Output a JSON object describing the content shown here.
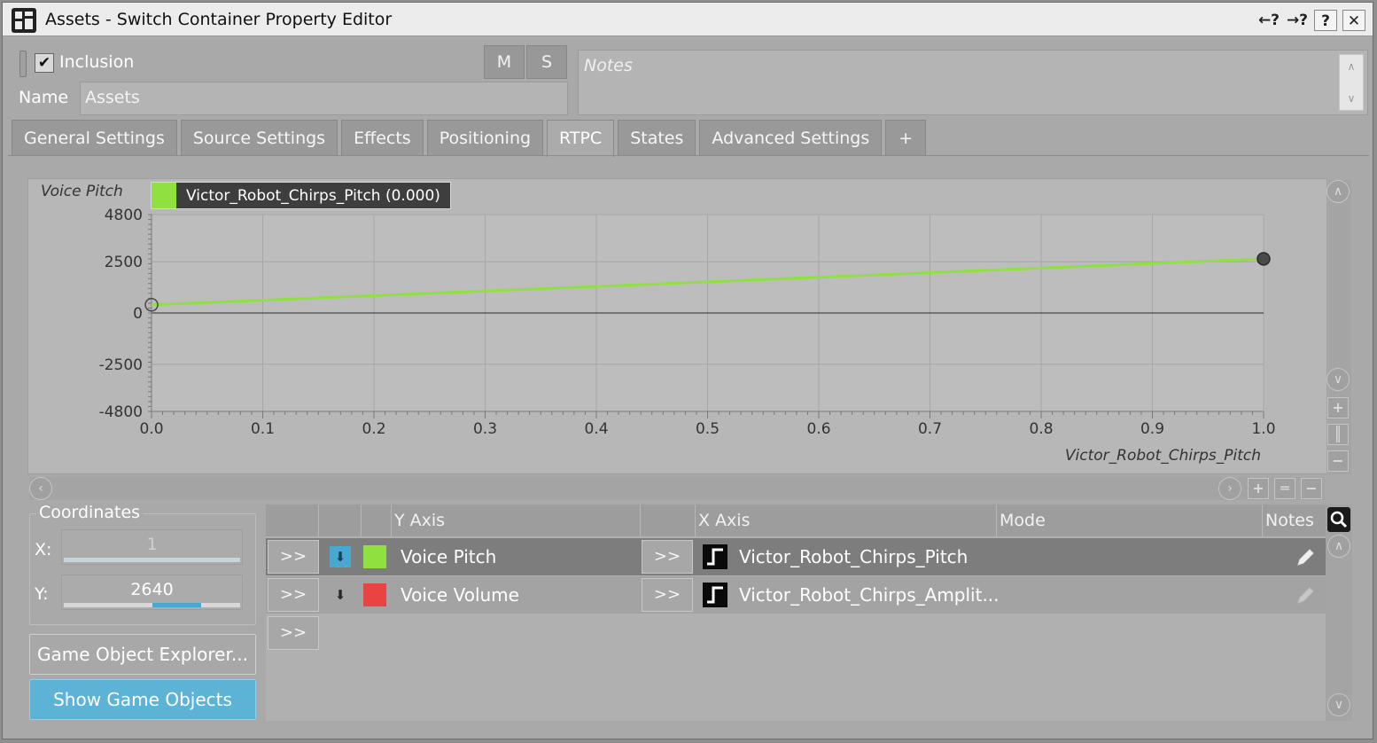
{
  "window": {
    "title": "Assets - Switch Container Property Editor",
    "title_buttons": [
      "¿?",
      "¿?",
      "?",
      "✕"
    ]
  },
  "header": {
    "inclusion_checked": true,
    "inclusion_label": "Inclusion",
    "name_label": "Name",
    "name_value": "Assets",
    "mute_label": "M",
    "solo_label": "S",
    "notes_placeholder": "Notes"
  },
  "tabs": [
    {
      "label": "General Settings",
      "active": false
    },
    {
      "label": "Source Settings",
      "active": false
    },
    {
      "label": "Effects",
      "active": false
    },
    {
      "label": "Positioning",
      "active": false
    },
    {
      "label": "RTPC",
      "active": true
    },
    {
      "label": "States",
      "active": false
    },
    {
      "label": "Advanced Settings",
      "active": false
    },
    {
      "label": "+",
      "active": false
    }
  ],
  "graph": {
    "y_axis_label": "Voice Pitch",
    "legend_label": "Victor_Robot_Chirps_Pitch (0.000)",
    "legend_color": "#90e040",
    "x_axis_label": "Victor_Robot_Chirps_Pitch",
    "y_ticks": [
      "4800",
      "2500",
      "0",
      "-2500",
      "-4800"
    ],
    "x_ticks": [
      "0.0",
      "0.1",
      "0.2",
      "0.3",
      "0.4",
      "0.5",
      "0.6",
      "0.7",
      "0.8",
      "0.9",
      "1.0"
    ]
  },
  "chart_data": {
    "type": "line",
    "title": "",
    "xlabel": "Victor_Robot_Chirps_Pitch",
    "ylabel": "Voice Pitch",
    "xlim": [
      0.0,
      1.0
    ],
    "ylim": [
      -4800,
      4800
    ],
    "grid": true,
    "legend": "top-left",
    "series": [
      {
        "name": "Victor_Robot_Chirps_Pitch (0.000)",
        "color": "#90e040",
        "x": [
          0.0,
          1.0
        ],
        "y": [
          400,
          2640
        ]
      }
    ]
  },
  "coordinates": {
    "title": "Coordinates",
    "x_label": "X:",
    "x_value": "1",
    "y_label": "Y:",
    "y_value": "2640",
    "y_level": 0.78
  },
  "buttons": {
    "game_object_explorer": "Game Object Explorer...",
    "show_game_objects": "Show Game Objects"
  },
  "rtpc_table": {
    "columns": [
      "Y Axis",
      "X Axis",
      "Mode",
      "Notes"
    ],
    "rows": [
      {
        "arrow_y": ">>",
        "pinned": true,
        "color": "#90e040",
        "y_axis": "Voice Pitch",
        "arrow_x": ">>",
        "x_axis": "Victor_Robot_Chirps_Pitch",
        "selected": true
      },
      {
        "arrow_y": ">>",
        "pinned": false,
        "color": "#e84444",
        "y_axis": "Voice Volume",
        "arrow_x": ">>",
        "x_axis": "Victor_Robot_Chirps_Amplit...",
        "selected": false
      }
    ],
    "empty_row_arrow": ">>"
  }
}
